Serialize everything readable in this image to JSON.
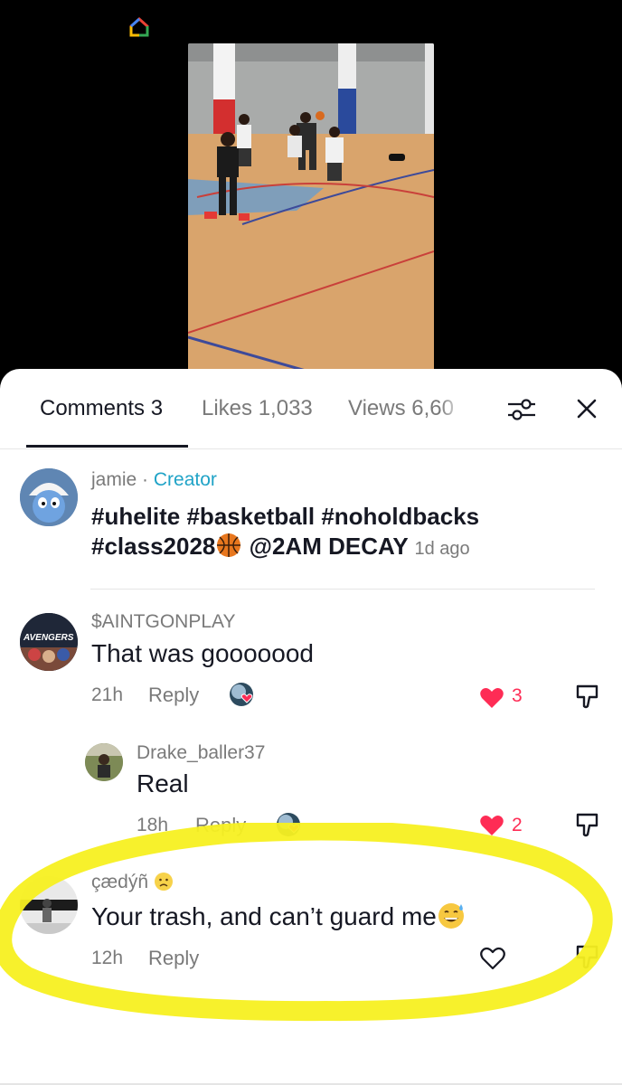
{
  "tabs": {
    "comments_label": "Comments",
    "comments_count": "3",
    "likes_label": "Likes",
    "likes_count": "1,033",
    "views_label": "Views",
    "views_count": "6,60"
  },
  "comments": [
    {
      "username": "jamie",
      "separator": " · ",
      "badge": "Creator",
      "text_line1": "#uhelite #basketball #noholdbacks",
      "text_line2": "#class2028",
      "mention": " @2AM DECAY",
      "time": "1d ago"
    },
    {
      "username": "$AINTGONPLAY",
      "text": "That was gooooood",
      "time": "21h",
      "reply_label": "Reply",
      "likes": "3",
      "avatar_text": "AVENGERS"
    },
    {
      "username": "Drake_baller37",
      "text": "Real",
      "time": "18h",
      "reply_label": "Reply",
      "likes": "2"
    },
    {
      "username": "çædýñ",
      "text": "Your trash, and can’t guard me",
      "time": "12h",
      "reply_label": "Reply"
    }
  ],
  "colors": {
    "accent_blue": "#20a3c7",
    "like_red": "#fe2c55",
    "highlight_yellow": "#f7f021"
  },
  "icons": [
    "home-icon",
    "filter-sliders-icon",
    "close-icon",
    "heart-icon",
    "dislike-icon",
    "basketball-emoji",
    "sweat-smile-emoji",
    "frown-emoji"
  ]
}
